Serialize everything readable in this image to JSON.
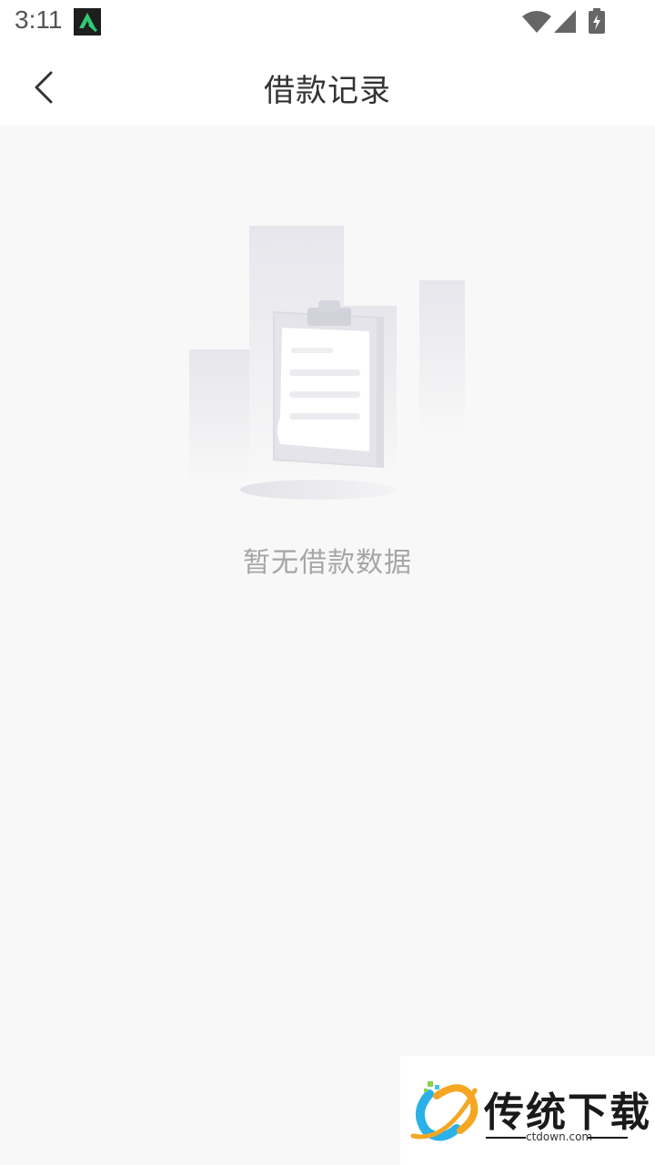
{
  "status_bar": {
    "time": "3:11"
  },
  "header": {
    "title": "借款记录",
    "back_icon": "chevron-left-icon"
  },
  "empty_state": {
    "illustration": "empty-clipboard-illustration",
    "message": "暂无借款数据"
  },
  "watermark": {
    "title": "传统下载",
    "url": "ctdown.com"
  },
  "colors": {
    "page_background": "#f8f8f8",
    "header_background": "#ffffff",
    "title_text": "#333333",
    "empty_text": "#a6a6a6"
  }
}
